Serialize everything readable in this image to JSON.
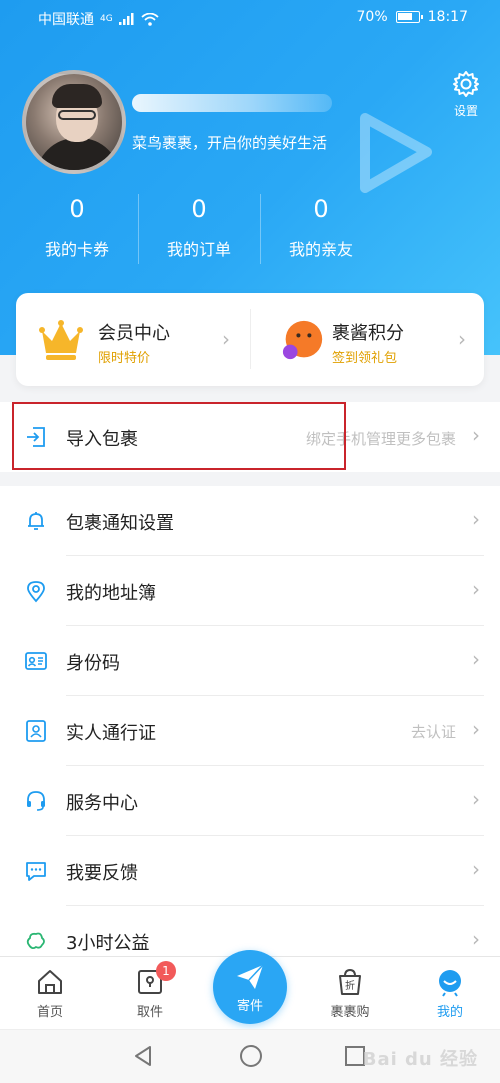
{
  "status_bar": {
    "carrier": "中国联通",
    "network": "4G",
    "battery": "70%",
    "time": "18:17"
  },
  "profile": {
    "slogan": "菜鸟裹裹，开启你的美好生活",
    "settings_label": "设置"
  },
  "stats": [
    {
      "value": "0",
      "label": "我的卡券"
    },
    {
      "value": "0",
      "label": "我的订单"
    },
    {
      "value": "0",
      "label": "我的亲友"
    }
  ],
  "member_card": {
    "vip": {
      "title": "会员中心",
      "subtitle": "限时特价"
    },
    "points": {
      "title": "裹酱积分",
      "subtitle": "签到领礼包"
    }
  },
  "import_row": {
    "label": "导入包裹",
    "hint": "绑定手机管理更多包裹"
  },
  "menu": [
    {
      "label": "包裹通知设置",
      "icon": "bell-icon"
    },
    {
      "label": "我的地址簿",
      "icon": "location-pin-icon"
    },
    {
      "label": "身份码",
      "icon": "id-card-icon"
    },
    {
      "label": "实人通行证",
      "icon": "person-badge-icon",
      "hint": "去认证"
    },
    {
      "label": "服务中心",
      "icon": "headset-icon"
    },
    {
      "label": "我要反馈",
      "icon": "chat-icon"
    },
    {
      "label": "3小时公益",
      "icon": "charity-icon"
    }
  ],
  "tabbar": {
    "home": "首页",
    "pickup": "取件",
    "pickup_badge": "1",
    "send": "寄件",
    "shop": "裹裹购",
    "mine": "我的"
  },
  "watermark": "Bai du 经验",
  "colors": {
    "brand_blue": "#2aa6f4",
    "accent_gold": "#e0a000",
    "badge_red": "#f25a5a",
    "highlight_box": "#c9242b"
  }
}
